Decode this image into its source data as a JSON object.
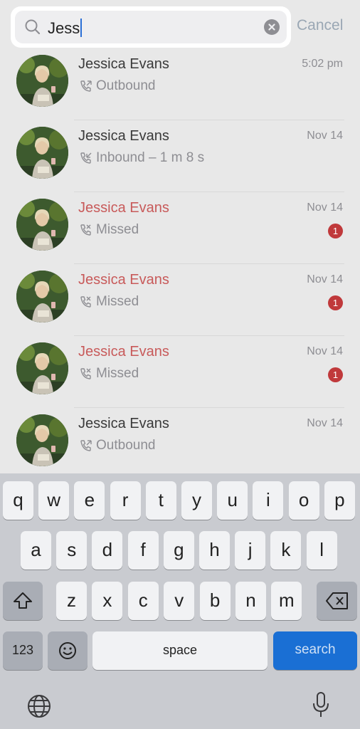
{
  "search": {
    "query": "Jess",
    "cancel_label": "Cancel"
  },
  "calls": [
    {
      "name": "Jessica Evans",
      "detail": "Outbound",
      "time": "5:02 pm",
      "type": "outbound",
      "missed": false,
      "badge": ""
    },
    {
      "name": "Jessica Evans",
      "detail": "Inbound – 1 m 8 s",
      "time": "Nov 14",
      "type": "inbound",
      "missed": false,
      "badge": ""
    },
    {
      "name": "Jessica Evans",
      "detail": "Missed",
      "time": "Nov 14",
      "type": "missed",
      "missed": true,
      "badge": "1"
    },
    {
      "name": "Jessica Evans",
      "detail": "Missed",
      "time": "Nov 14",
      "type": "missed",
      "missed": true,
      "badge": "1"
    },
    {
      "name": "Jessica Evans",
      "detail": "Missed",
      "time": "Nov 14",
      "type": "missed",
      "missed": true,
      "badge": "1"
    },
    {
      "name": "Jessica Evans",
      "detail": "Outbound",
      "time": "Nov 14",
      "type": "outbound",
      "missed": false,
      "badge": ""
    }
  ],
  "keyboard": {
    "row1": [
      "q",
      "w",
      "e",
      "r",
      "t",
      "y",
      "u",
      "i",
      "o",
      "p"
    ],
    "row2": [
      "a",
      "s",
      "d",
      "f",
      "g",
      "h",
      "j",
      "k",
      "l"
    ],
    "row3": [
      "z",
      "x",
      "c",
      "v",
      "b",
      "n",
      "m"
    ],
    "numbers_label": "123",
    "space_label": "space",
    "search_label": "search"
  },
  "colors": {
    "missed": "#c85a5a",
    "badge": "#c0393b",
    "search_key": "#1a6fd4"
  }
}
